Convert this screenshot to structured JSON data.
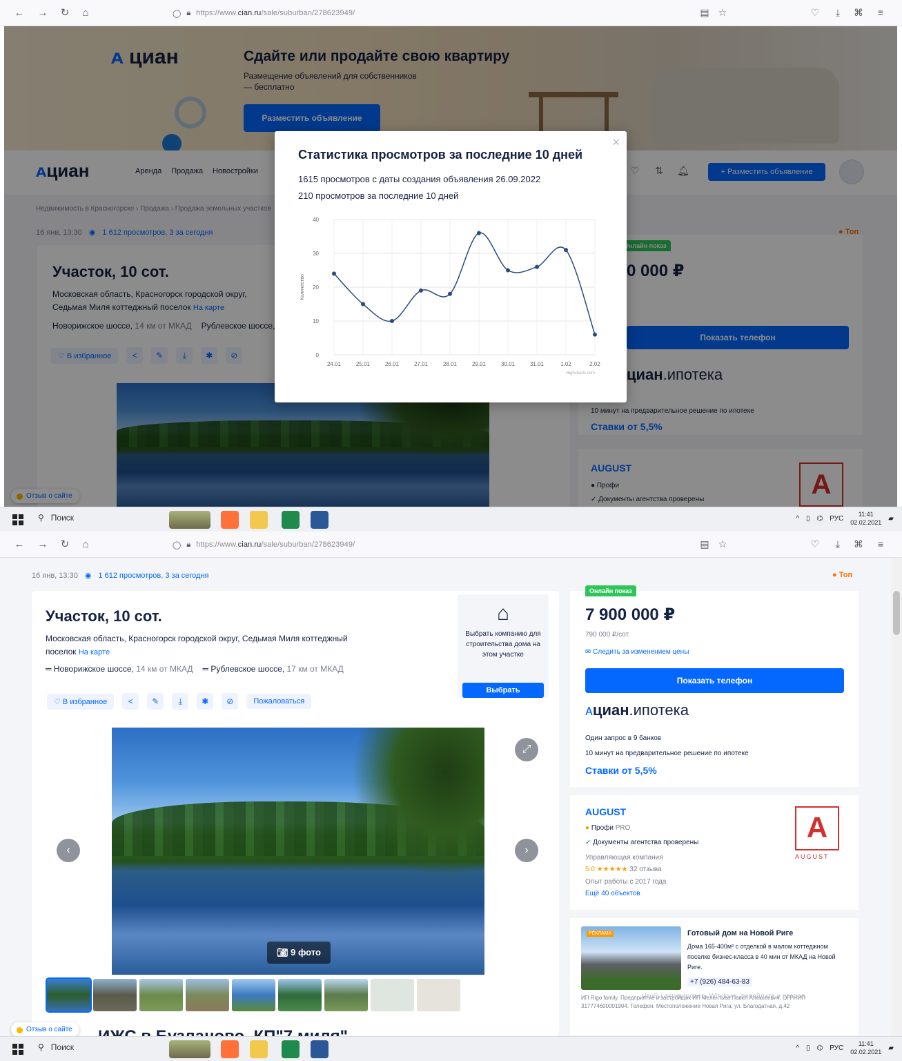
{
  "browser": {
    "url_prefix": "https://www.",
    "url_domain": "cian.ru",
    "url_path": "/sale/suburban/278623949/"
  },
  "taskbar": {
    "search_label": "Поиск",
    "lang": "РУС",
    "time": "11:41",
    "date": "02.02.2021"
  },
  "banner": {
    "logo": "циан",
    "title": "Сдайте или продайте свою квартиру",
    "subtitle": "Размещение объявлений для собственников — бесплатно",
    "button": "Разместить объявление"
  },
  "header": {
    "logo": "циан",
    "nav": [
      "Аренда",
      "Продажа",
      "Новостройки"
    ],
    "place_ad": "+ Разместить объявление"
  },
  "breadcrumbs": "Недвижимость в Красногорске › Продажа › Продажа земельных участков",
  "listing": {
    "date": "16 янв, 13:30",
    "views": "1 612 просмотров, 3 за сегодня",
    "top_label": "Топ",
    "title": "Участок, 10 сот.",
    "address_line1": "Московская область, Красногорск городской округ, Седьмая Миля коттеджный",
    "address_line2": "поселок",
    "map_link": "На карте",
    "highway1": "Новорижское шоссе,",
    "highway1_km": "14 км от МКАД",
    "highway2": "Рублевское шоссе,",
    "highway2_km": "17 км от МКАД",
    "favorite": "В избранное",
    "complain": "Пожаловаться",
    "builder_text": "Выбрать компанию для строительства дома на этом участке",
    "builder_button": "Выбрать",
    "photo_count": "9 фото",
    "section_title": "ИЖС в Бузланово, КП\"7 миля\""
  },
  "sidebar": {
    "badge": "Онлайн показ",
    "price": "7 900 000 ₽",
    "price_partial": "0 000 ₽",
    "price_per": "790 000 ₽/сот.",
    "watch": "Следить за изменением цены",
    "phone_button": "Показать телефон",
    "mortgage_logo_bold": "циан",
    "mortgage_logo_rest": ".ипотека",
    "mortgage_line1": "Один запрос в 9 банков",
    "mortgage_line2": "10 минут на предварительное решение по ипотеке",
    "mortgage_rate": "Ставки от 5,5%",
    "agency_name": "AUGUST",
    "agency_level": "Профи",
    "agency_pro": "PRO",
    "agency_docs": "Документы агентства проверены",
    "agency_type": "Управляющая компания",
    "agency_rating": "5.0",
    "agency_reviews": "32 отзыва",
    "agency_exp": "Опыт работы с 2017 года",
    "agency_more": "Ещё 40 объектов",
    "agency_logo_text": "AUGUST",
    "ad_title": "Готовый дом на Новой Риге",
    "ad_text": "Дома 165-400м² с отделкой в малом коттеджном поселке бизнес-класса в 40 мин от МКАД на Новой Риге.",
    "ad_phone": "+7 (926) 484-63-83",
    "ad_label": "РЕКЛАМА",
    "ad_legal": "ИП Rigo family. Предприятие и застройщик ИП Мелентьев Павел Алексеевич. ОГРНИП 317774600001904. Телефон. Местоположение Новая Рига, ул. Благодатная, д.42",
    "windows_watermark": "Чтобы активировать Windows, перейдите в раздел"
  },
  "feedback": "Отзыв о сайте",
  "modal": {
    "title": "Статистика просмотров за последние 10 дней",
    "line1": "1615 просмотров с даты создания объявления 26.09.2022",
    "line2": "210 просмотров за последние 10 дней",
    "credit": "Highcharts.com"
  },
  "chart_data": {
    "type": "line",
    "title": "",
    "xlabel": "",
    "ylabel": "Количество",
    "categories": [
      "24.01",
      "25.01",
      "26.01",
      "27.01",
      "28.01",
      "29.01",
      "30.01",
      "31.01",
      "1.02",
      "2.02"
    ],
    "values": [
      24,
      15,
      10,
      19,
      18,
      36,
      25,
      26,
      31,
      6
    ],
    "ylim": [
      0,
      40
    ],
    "yticks": [
      0,
      10,
      20,
      30,
      40
    ],
    "grid": true,
    "color": "#2b4b7e"
  },
  "colors": {
    "accent": "#0468ff",
    "text": "#152242",
    "badge_green": "#2fc55b",
    "agency_red": "#d32f2f"
  }
}
